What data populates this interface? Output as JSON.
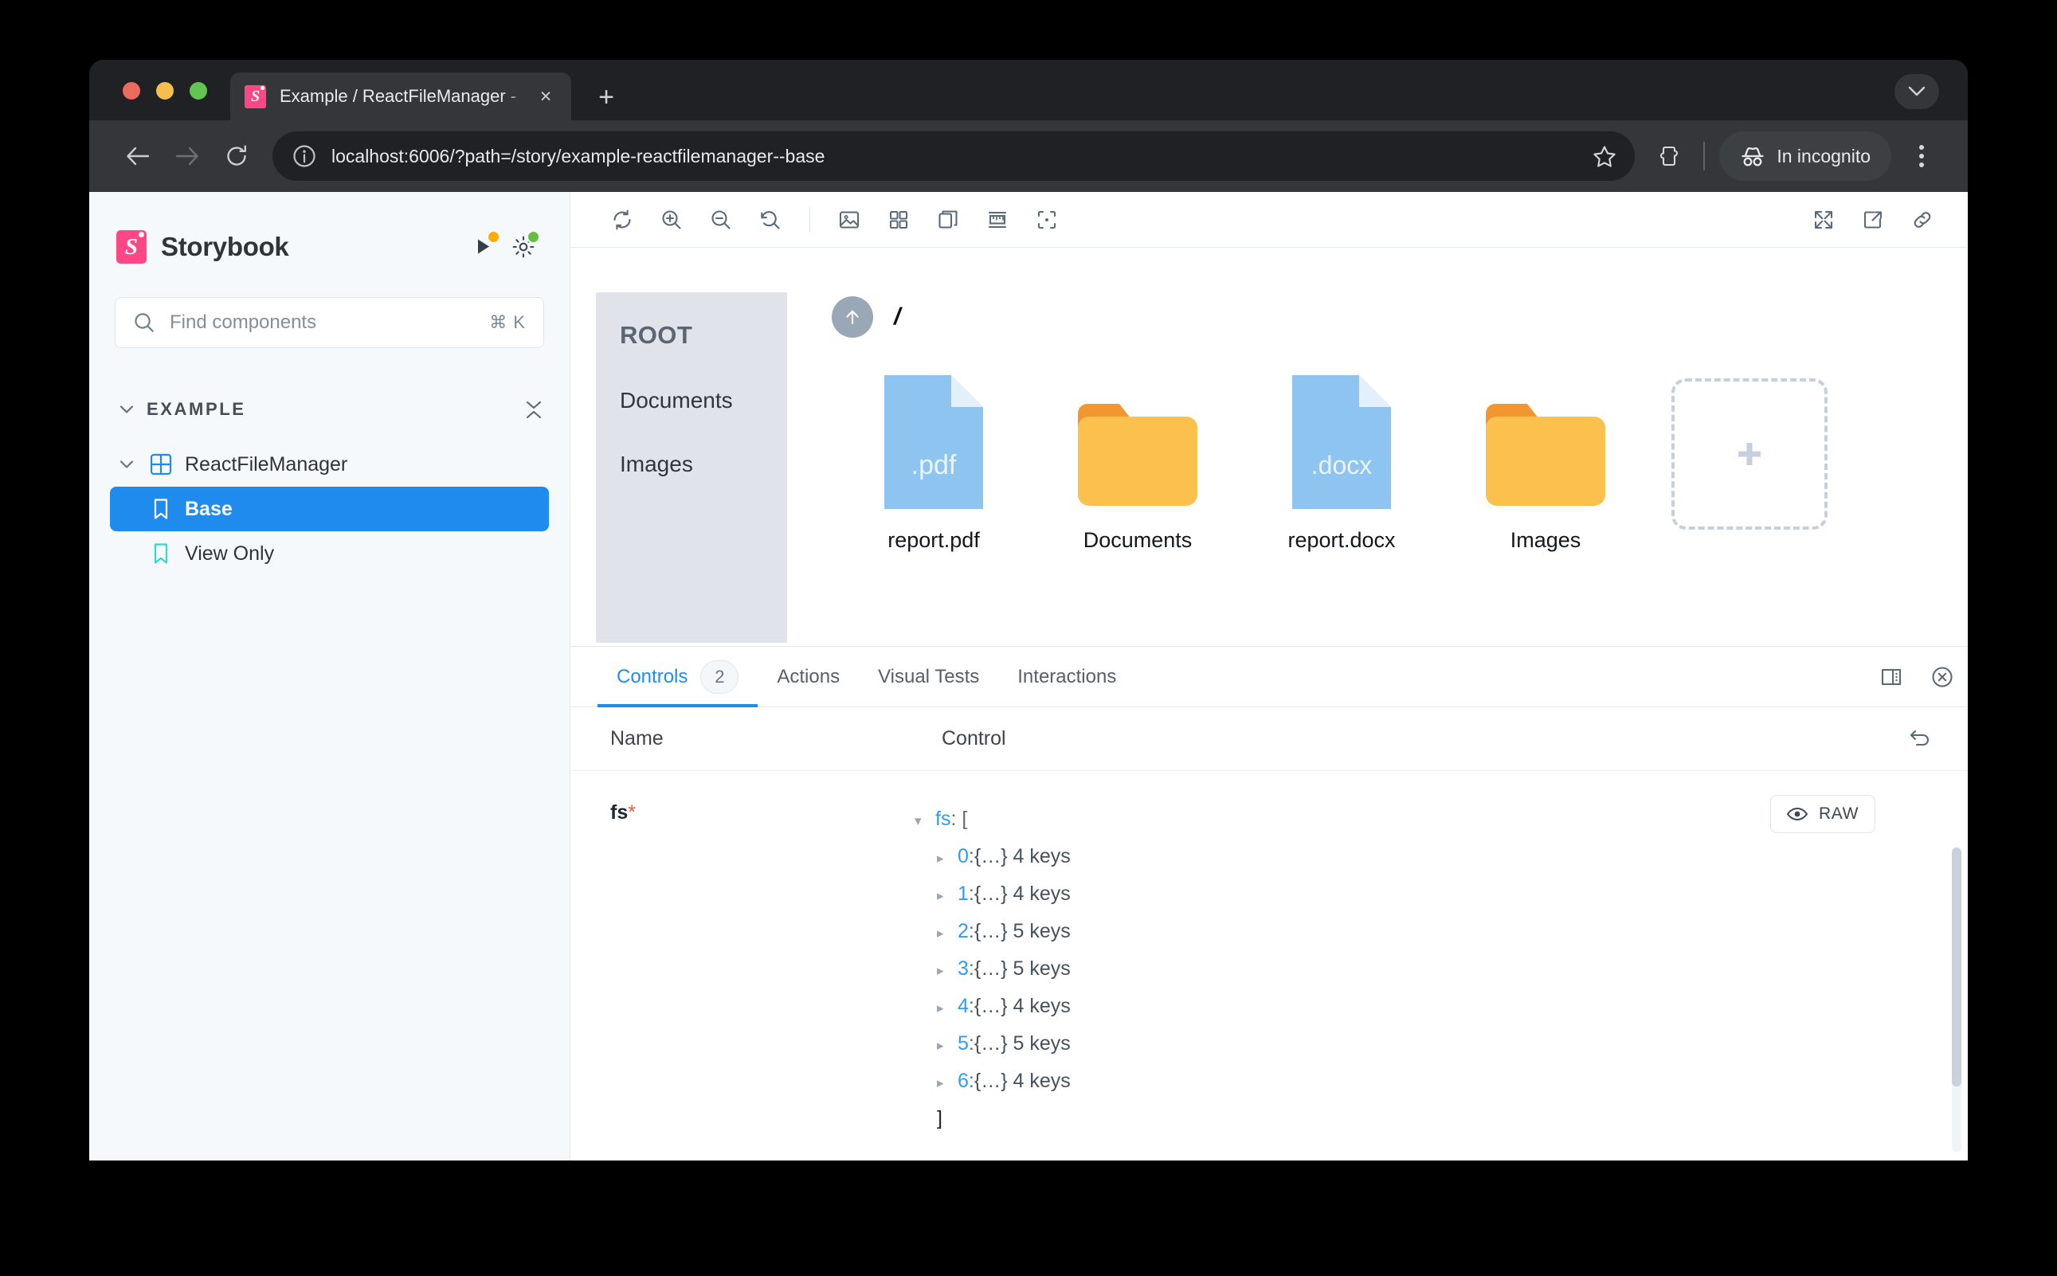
{
  "browser": {
    "tab": {
      "title": "Example / ReactFileManager -",
      "favicon_letter": "S",
      "close_label": "×"
    },
    "new_tab_label": "+",
    "url": "localhost:6006/?path=/story/example-reactfilemanager--base",
    "incognito_label": "In incognito"
  },
  "sidebar": {
    "brand": "Storybook",
    "logo_letter": "S",
    "search": {
      "placeholder": "Find components",
      "shortcut": "⌘ K"
    },
    "section": {
      "label": "EXAMPLE"
    },
    "tree": [
      {
        "label": "ReactFileManager",
        "type": "component",
        "selected": false
      },
      {
        "label": "Base",
        "type": "story",
        "selected": true
      },
      {
        "label": "View Only",
        "type": "story",
        "selected": false
      }
    ]
  },
  "canvas_toolbar": {
    "left_icons": [
      "remount-icon",
      "zoom-in-icon",
      "zoom-out-icon",
      "zoom-reset-icon",
      "background-icon",
      "grid-icon",
      "outline-icon",
      "measure-icon",
      "focus-icon"
    ],
    "right_icons": [
      "fullscreen-icon",
      "open-new-tab-icon",
      "copy-link-icon"
    ]
  },
  "file_manager": {
    "tree": {
      "root_label": "ROOT",
      "nodes": [
        "Documents",
        "Images"
      ]
    },
    "breadcrumb": "/",
    "up_button_label": "up",
    "items": [
      {
        "name": "report.pdf",
        "kind": "file",
        "ext": ".pdf"
      },
      {
        "name": "Documents",
        "kind": "folder",
        "ext": ""
      },
      {
        "name": "report.docx",
        "kind": "file",
        "ext": ".docx"
      },
      {
        "name": "Images",
        "kind": "folder",
        "ext": ""
      }
    ],
    "add_tile_label": "+"
  },
  "addon_panel": {
    "tabs": [
      {
        "label": "Controls",
        "badge": "2",
        "active": true
      },
      {
        "label": "Actions",
        "badge": "",
        "active": false
      },
      {
        "label": "Visual Tests",
        "badge": "",
        "active": false
      },
      {
        "label": "Interactions",
        "badge": "",
        "active": false
      }
    ],
    "columns": {
      "name": "Name",
      "control": "Control"
    },
    "control_row": {
      "name": "fs",
      "required_mark": "*",
      "raw_button": "RAW",
      "json": {
        "root_key": "fs",
        "open_bracket": ": [",
        "close_bracket": "]",
        "entries": [
          {
            "index": "0",
            "value": "{…} 4 keys"
          },
          {
            "index": "1",
            "value": "{…} 4 keys"
          },
          {
            "index": "2",
            "value": "{…} 5 keys"
          },
          {
            "index": "3",
            "value": "{…} 5 keys"
          },
          {
            "index": "4",
            "value": "{…} 4 keys"
          },
          {
            "index": "5",
            "value": "{…} 5 keys"
          },
          {
            "index": "6",
            "value": "{…} 4 keys"
          }
        ],
        "separator": " : "
      }
    }
  },
  "colors": {
    "brand_pink": "#ff4785",
    "accent_blue": "#1f8ced",
    "folder_yellow": "#fbc14c",
    "file_blue": "#8ec5f0",
    "required_red": "#e85c41"
  }
}
